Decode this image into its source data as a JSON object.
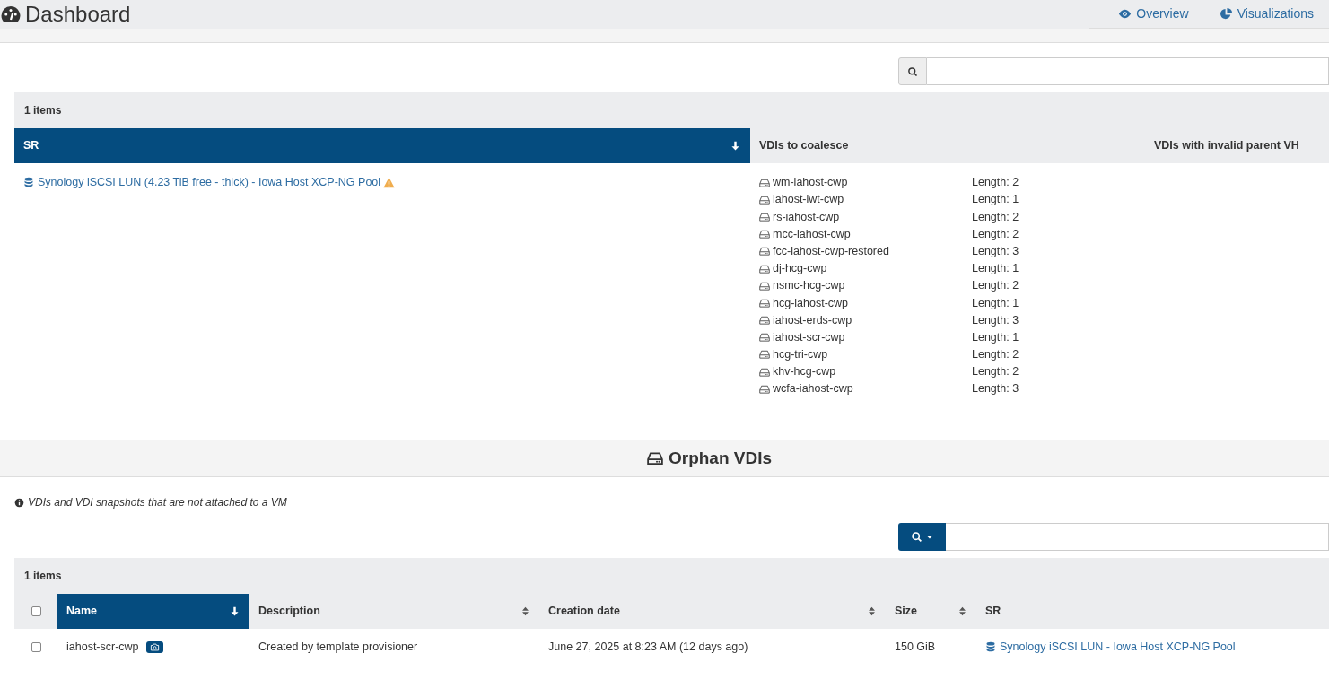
{
  "header": {
    "title": "Dashboard",
    "tabs": [
      {
        "label": "Overview"
      },
      {
        "label": "Visualizations"
      }
    ]
  },
  "unhealthy": {
    "count": "1 items",
    "columns": [
      {
        "label": "SR",
        "sorted": true
      },
      {
        "label": "VDIs to coalesce",
        "sorted": false
      },
      {
        "label": "VDIs with invalid parent VH",
        "sorted": false
      }
    ],
    "rows": [
      {
        "sr": "Synology iSCSI LUN (4.23 TiB free - thick) - Iowa Host XCP-NG Pool",
        "warning": true,
        "vdis": [
          {
            "name": "wm-iahost-cwp",
            "length": "Length: 2"
          },
          {
            "name": "iahost-iwt-cwp",
            "length": "Length: 1"
          },
          {
            "name": "rs-iahost-cwp",
            "length": "Length: 2"
          },
          {
            "name": "mcc-iahost-cwp",
            "length": "Length: 2"
          },
          {
            "name": "fcc-iahost-cwp-restored",
            "length": "Length: 3"
          },
          {
            "name": "dj-hcg-cwp",
            "length": "Length: 1"
          },
          {
            "name": "nsmc-hcg-cwp",
            "length": "Length: 2"
          },
          {
            "name": "hcg-iahost-cwp",
            "length": "Length: 1"
          },
          {
            "name": "iahost-erds-cwp",
            "length": "Length: 3"
          },
          {
            "name": "iahost-scr-cwp",
            "length": "Length: 1"
          },
          {
            "name": "hcg-tri-cwp",
            "length": "Length: 2"
          },
          {
            "name": "khv-hcg-cwp",
            "length": "Length: 2"
          },
          {
            "name": "wcfa-iahost-cwp",
            "length": "Length: 3"
          }
        ]
      }
    ]
  },
  "orphan": {
    "title": "Orphan VDIs",
    "info": "VDIs and VDI snapshots that are not attached to a VM",
    "count": "1 items",
    "select_all": {
      "checked": false
    },
    "columns": [
      {
        "label": "Name",
        "sorted": true,
        "sortable": true
      },
      {
        "label": "Description",
        "sorted": false,
        "sortable": true
      },
      {
        "label": "Creation date",
        "sorted": false,
        "sortable": true
      },
      {
        "label": "Size",
        "sorted": false,
        "sortable": true
      },
      {
        "label": "SR",
        "sorted": false,
        "sortable": false
      }
    ],
    "rows": [
      {
        "checked": false,
        "name": "iahost-scr-cwp",
        "snapshot": true,
        "description": "Created by template provisioner",
        "created": "June 27, 2025 at 8:23 AM (12 days ago)",
        "size": "150 GiB",
        "sr": "Synology iSCSI LUN - Iowa Host XCP-NG Pool"
      }
    ]
  }
}
